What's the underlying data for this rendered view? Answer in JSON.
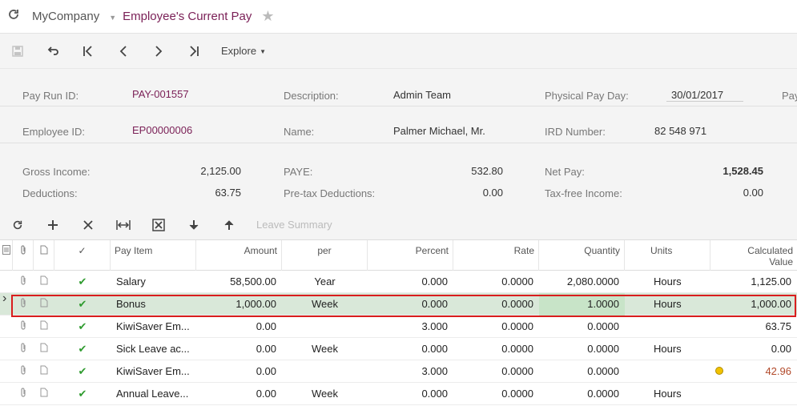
{
  "header": {
    "company": "MyCompany",
    "title": "Employee's Current Pay"
  },
  "toolbar": {
    "explore": "Explore"
  },
  "form": {
    "pay_run_id_label": "Pay Run ID:",
    "pay_run_id": "PAY-001557",
    "description_label": "Description:",
    "description": "Admin Team",
    "physical_pay_day_label": "Physical Pay Day:",
    "physical_pay_day": "30/01/2017",
    "truncated_label": "Pay",
    "employee_id_label": "Employee ID:",
    "employee_id": "EP00000006",
    "name_label": "Name:",
    "name": "Palmer Michael, Mr.",
    "ird_label": "IRD Number:",
    "ird": "82 548 971",
    "gross_income_label": "Gross Income:",
    "gross_income": "2,125.00",
    "paye_label": "PAYE:",
    "paye": "532.80",
    "net_pay_label": "Net Pay:",
    "net_pay": "1,528.45",
    "deductions_label": "Deductions:",
    "deductions": "63.75",
    "pretax_label": "Pre-tax Deductions:",
    "pretax": "0.00",
    "taxfree_label": "Tax-free Income:",
    "taxfree": "0.00"
  },
  "grid_toolbar": {
    "leave_summary": "Leave Summary"
  },
  "grid": {
    "columns": {
      "pay_item": "Pay Item",
      "amount": "Amount",
      "per": "per",
      "percent": "Percent",
      "rate": "Rate",
      "quantity": "Quantity",
      "units": "Units",
      "calc_line1": "Calculated",
      "calc_line2": "Value"
    },
    "rows": [
      {
        "item": "Salary",
        "amount": "58,500.00",
        "per": "Year",
        "percent": "0.000",
        "rate": "0.0000",
        "quantity": "2,080.0000",
        "units": "Hours",
        "calc": "1,125.00"
      },
      {
        "item": "Bonus",
        "amount": "1,000.00",
        "per": "Week",
        "percent": "0.000",
        "rate": "0.0000",
        "quantity": "1.0000",
        "units": "Hours",
        "calc": "1,000.00"
      },
      {
        "item": "KiwiSaver Em...",
        "amount": "0.00",
        "per": "",
        "percent": "3.000",
        "rate": "0.0000",
        "quantity": "0.0000",
        "units": "",
        "calc": "63.75"
      },
      {
        "item": "Sick Leave ac...",
        "amount": "0.00",
        "per": "Week",
        "percent": "0.000",
        "rate": "0.0000",
        "quantity": "0.0000",
        "units": "Hours",
        "calc": "0.00"
      },
      {
        "item": "KiwiSaver Em...",
        "amount": "0.00",
        "per": "",
        "percent": "3.000",
        "rate": "0.0000",
        "quantity": "0.0000",
        "units": "",
        "calc": "42.96"
      },
      {
        "item": "Annual Leave...",
        "amount": "0.00",
        "per": "Week",
        "percent": "0.000",
        "rate": "0.0000",
        "quantity": "0.0000",
        "units": "Hours",
        "calc": ""
      }
    ]
  },
  "colors": {
    "accent": "#7a1f56",
    "selected_row": "#d9e8d9",
    "selection_border": "#d91e1e",
    "warning_value": "#b24a2b",
    "check": "#2e9b2e"
  }
}
